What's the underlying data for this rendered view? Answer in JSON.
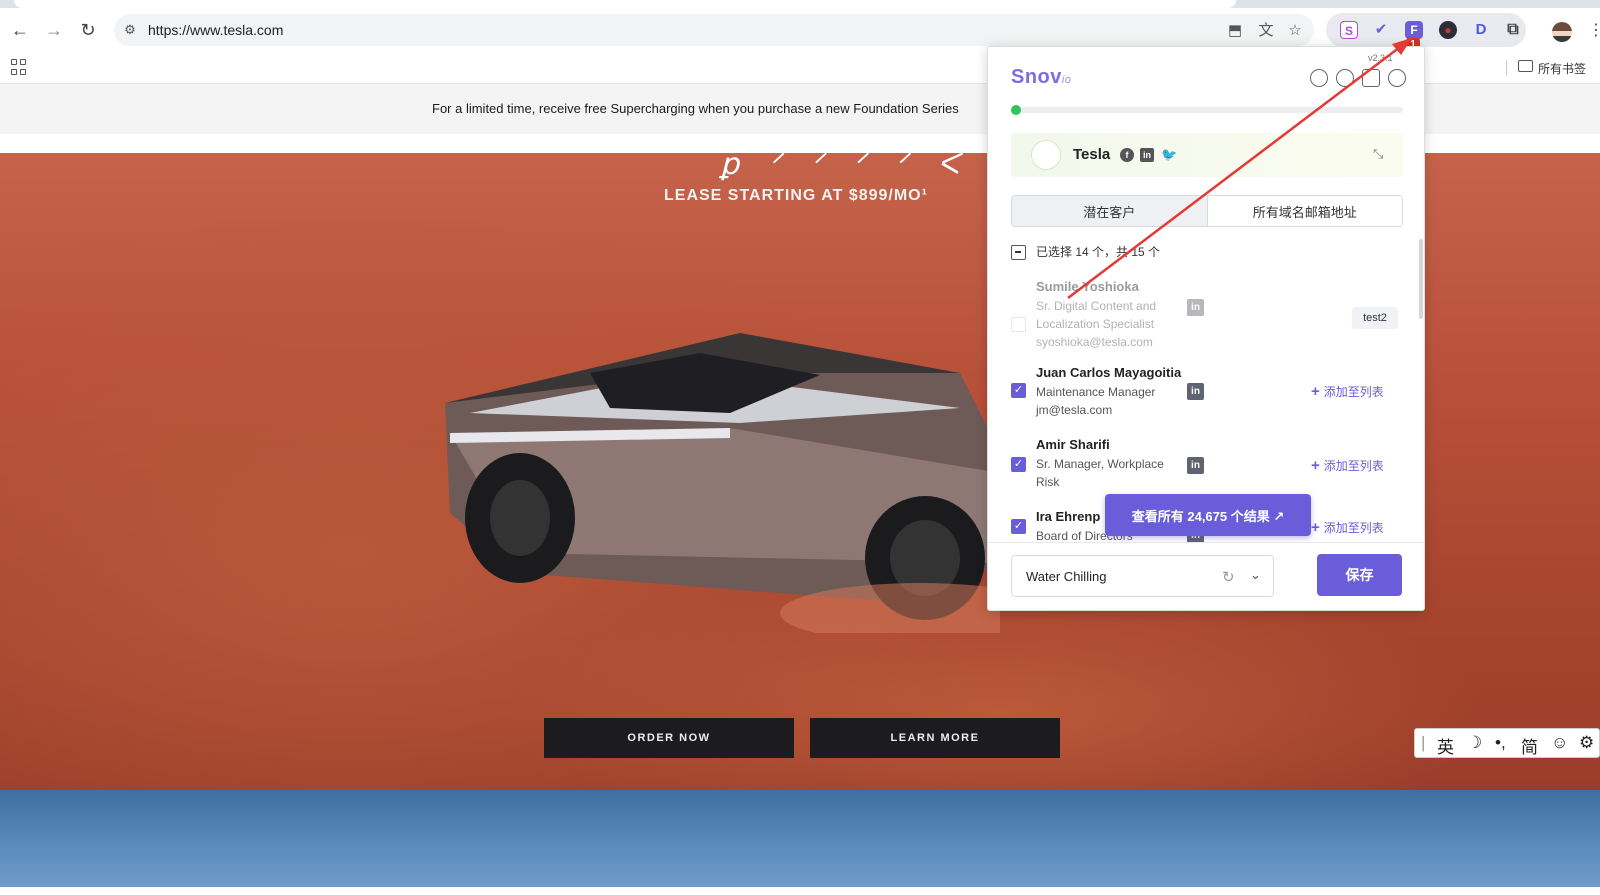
{
  "browser": {
    "url": "https://www.tesla.com",
    "bookmarks_all": "所有书签",
    "extensions": [
      "S",
      "✔",
      "F",
      "●",
      "D"
    ],
    "extension_badge": "1"
  },
  "page": {
    "promo_text": "For a limited time, receive free Supercharging when you purchase a new Foundation Series",
    "hero_script": "ꝑ ᐟ ᐟ ᐟ ᐟ ᐸ",
    "lease_text": "LEASE STARTING AT $899/MO¹",
    "order_now": "ORDER NOW",
    "learn_more": "LEARN MORE"
  },
  "ime": {
    "items": [
      "英",
      "☽",
      "•,",
      "简",
      "☺",
      "⚙"
    ]
  },
  "snov": {
    "version": "v2.3.1",
    "logo_main": "Snov",
    "logo_suffix": "io",
    "company": {
      "name": "Tesla",
      "social": [
        "f",
        "in",
        "🐦"
      ]
    },
    "tabs": [
      "潜在客户",
      "所有域名邮箱地址"
    ],
    "selection_text": "已选择 14 个，共 15 个",
    "prospects": [
      {
        "name": "Sumile Yoshioka",
        "title": "Sr. Digital Content and Localization Specialist",
        "email": "syoshioka@tesla.com",
        "tag": "test2",
        "checked": false
      },
      {
        "name": "Juan Carlos Mayagoitia",
        "title": "Maintenance Manager",
        "email": "jm@tesla.com",
        "action": "添加至列表",
        "checked": true
      },
      {
        "name": "Amir Sharifi",
        "title": "Sr. Manager, Workplace Risk",
        "email": "",
        "action": "添加至列表",
        "checked": true
      },
      {
        "name": "Ira Ehrenp",
        "title": "Board of Directors",
        "email": "",
        "action": "添加至列表",
        "checked": true
      }
    ],
    "view_all": "查看所有 24,675 个结果 ↗",
    "list_select_value": "Water Chilling",
    "save_label": "保存",
    "accent_color": "#6a5dd9"
  }
}
